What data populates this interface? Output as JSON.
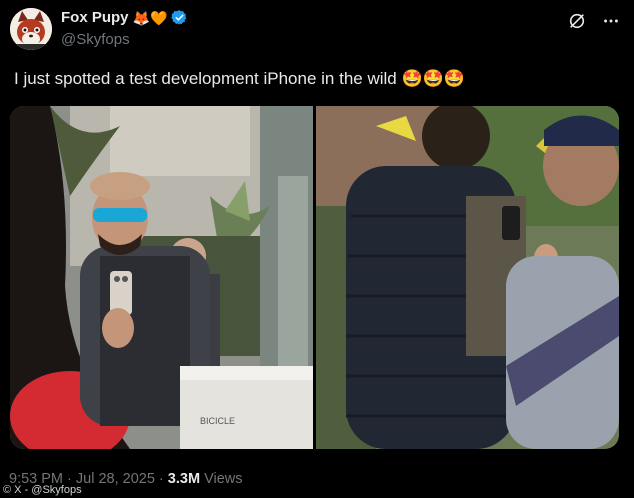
{
  "author": {
    "display_name": "Fox Pupy",
    "name_emoji": "🦊🧡",
    "handle": "@Skyfops",
    "verified_color": "#1d9bf0"
  },
  "tweet": {
    "text": "I just spotted a test development iPhone in the wild 🤩🤩🤩"
  },
  "meta": {
    "time": "9:53 PM",
    "sep1": " · ",
    "date": "Jul 28, 2025",
    "sep2": " · ",
    "views_count": "3.3M",
    "views_label": " Views"
  },
  "watermark": "© X - @Skyfops",
  "icons": [
    "grok-icon",
    "more-icon",
    "verified-badge-icon"
  ],
  "photos": {
    "left_sign_text": "BICICLE",
    "left_subject": "man-with-test-iphone",
    "right_subject": "man-in-puffer-vest"
  }
}
